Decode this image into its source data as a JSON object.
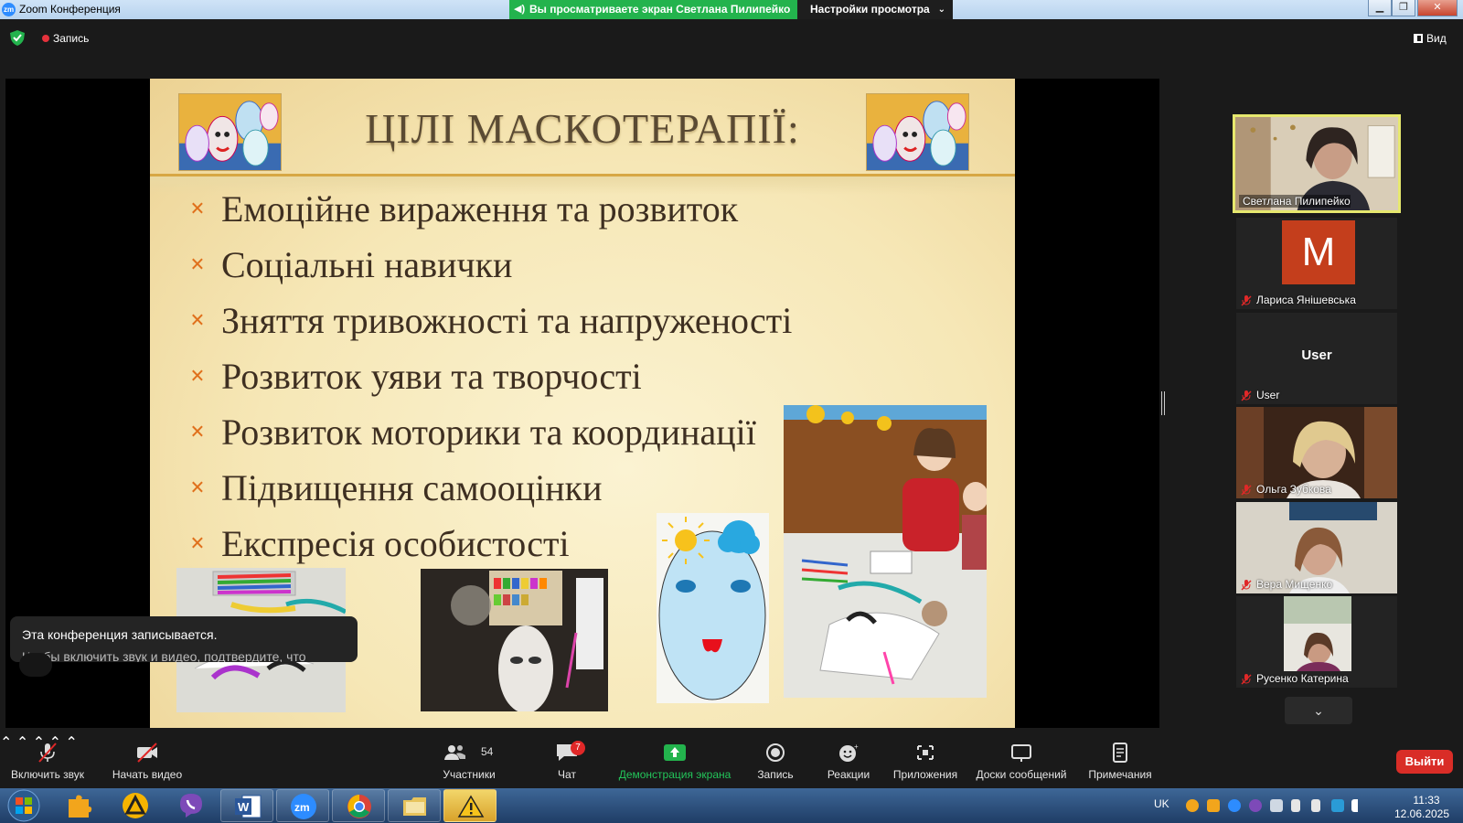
{
  "window": {
    "app_logo": "zm",
    "title": "Zoom Конференция",
    "share_banner": "Вы просматриваете экран Светлана Пилипейко",
    "view_options": "Настройки просмотра"
  },
  "top_bar": {
    "record_label": "Запись",
    "view_label": "Вид"
  },
  "slide": {
    "title": "ЦІЛІ  МАСКОТЕРАПІЇ:",
    "bullet_marker": "×",
    "bullets": [
      "Емоційне вираження та розвиток",
      "Соціальні навички",
      "Зняття тривожності та напруженості",
      "Розвиток уяви та творчості",
      "Розвиток моторики та координації",
      "Підвищення самооцінки",
      "Експресія особистості"
    ]
  },
  "participants": [
    {
      "name": "Светлана Пилипейко",
      "active": true,
      "muted": false
    },
    {
      "name": "Лариса Янішевська",
      "avatar_letter": "M",
      "muted": true
    },
    {
      "name": "User",
      "display": "User",
      "muted": true
    },
    {
      "name": "Ольга Зубкова",
      "muted": true
    },
    {
      "name": "Вера Мищенко",
      "muted": true
    },
    {
      "name": "Русенко Катерина",
      "muted": true
    }
  ],
  "toast": {
    "line1": "Эта конференция записывается.",
    "line2": "Чтобы включить звук и видео, подтвердите, что"
  },
  "toolbar": {
    "unmute": "Включить звук",
    "start_video": "Начать видео",
    "participants": "Участники",
    "participants_count": "54",
    "chat": "Чат",
    "chat_badge": "7",
    "share_screen": "Демонстрация экрана",
    "record": "Запись",
    "reactions": "Реакции",
    "apps": "Приложения",
    "whiteboards": "Доски сообщений",
    "notes": "Примечания",
    "leave": "Выйти"
  },
  "taskbar": {
    "language": "UK",
    "time": "11:33",
    "date": "12.06.2025",
    "zoom_label": "zm"
  },
  "colors": {
    "share_green": "#23b34d",
    "leave_red": "#d92d27",
    "active_speaker_border": "#e6e86e",
    "slide_bullet_orange": "#e0701c"
  }
}
